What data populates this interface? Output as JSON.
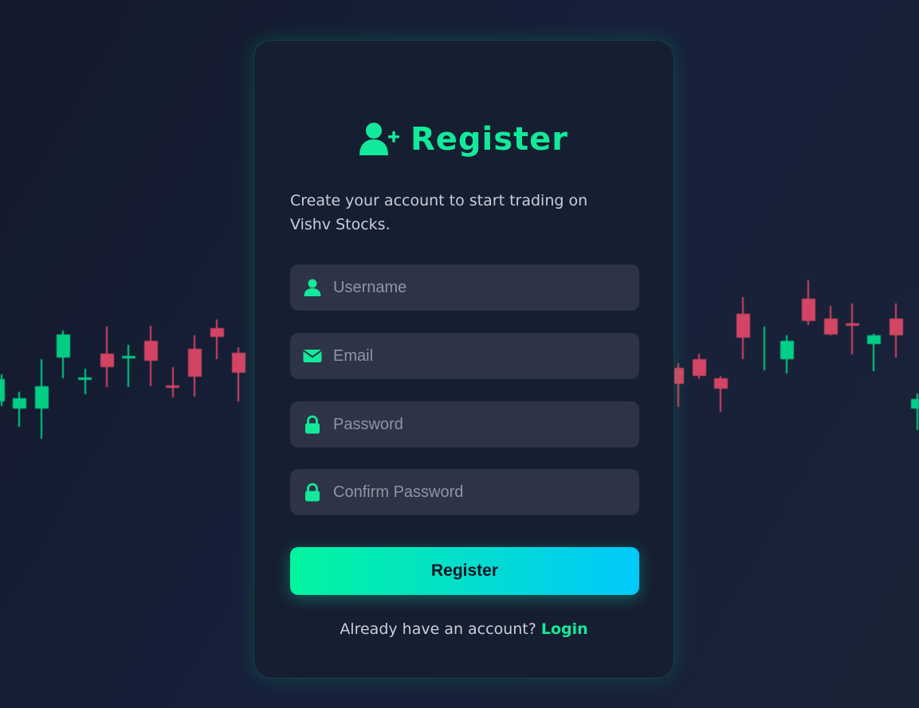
{
  "colors": {
    "accent": "#13e99a",
    "bullish": "#00e290",
    "bearish": "#e8496a",
    "card_bg": "#161f31",
    "field_bg": "#2c3446",
    "button_gradient_start": "#03f59e",
    "button_gradient_end": "#00c9fb"
  },
  "header": {
    "icon": "user-plus-icon",
    "title": "Register"
  },
  "subtitle": "Create your account to start trading on Vishv Stocks.",
  "form": {
    "fields": [
      {
        "icon": "user-icon",
        "placeholder": "Username",
        "value": ""
      },
      {
        "icon": "envelope-icon",
        "placeholder": "Email",
        "value": ""
      },
      {
        "icon": "lock-icon",
        "placeholder": "Password",
        "value": ""
      },
      {
        "icon": "lock-icon",
        "placeholder": "Confirm Password",
        "value": ""
      }
    ],
    "submit_label": "Register"
  },
  "footer": {
    "prompt": "Already have an account?",
    "link_label": "Login"
  }
}
